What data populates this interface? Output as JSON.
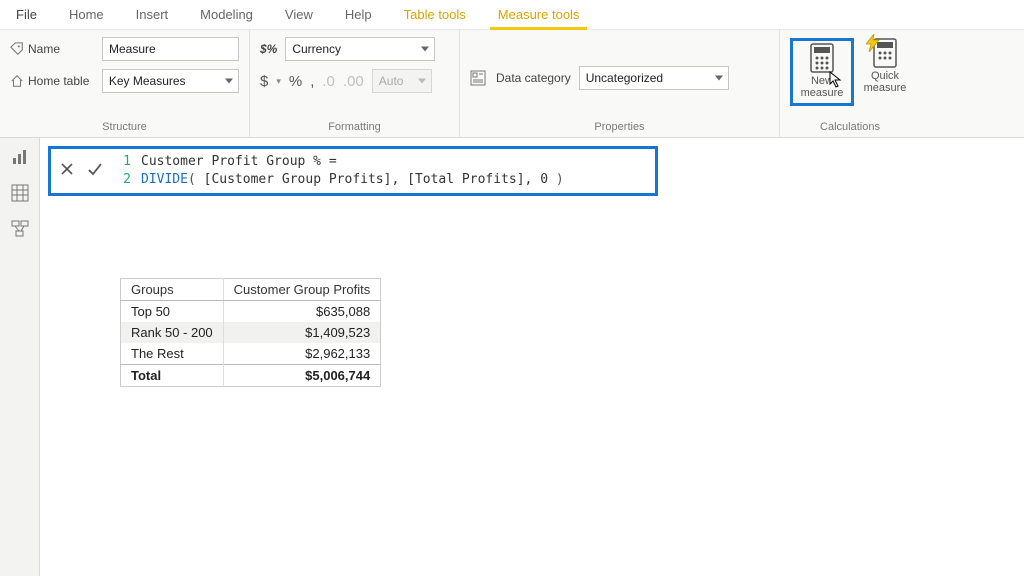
{
  "menubar": {
    "file": "File",
    "items": [
      "Home",
      "Insert",
      "Modeling",
      "View",
      "Help"
    ],
    "contextual": [
      "Table tools",
      "Measure tools"
    ],
    "active": "Measure tools"
  },
  "ribbon": {
    "structure": {
      "name_label": "Name",
      "name_value": "Measure",
      "home_table_label": "Home table",
      "home_table_value": "Key Measures",
      "group_label": "Structure"
    },
    "formatting": {
      "format_prefix": "$%",
      "format_value": "Currency",
      "dollar": "$",
      "percent": "%",
      "comma": ",",
      "dec_inc": ".0",
      "dec_dec": ".00",
      "decimals_value": "Auto",
      "group_label": "Formatting"
    },
    "properties": {
      "data_category_label": "Data category",
      "data_category_value": "Uncategorized",
      "group_label": "Properties"
    },
    "calculations": {
      "new_measure": "New measure",
      "quick_measure": "Quick measure",
      "group_label": "Calculations"
    }
  },
  "formula": {
    "line1_prefix": "Customer Profit Group % =",
    "line2_func": "DIVIDE",
    "line2_open": "(",
    "line2_arg1": " [Customer Group Profits]",
    "line2_sep1": ", ",
    "line2_arg2": "[Total Profits]",
    "line2_sep2": ", ",
    "line2_arg3": "0 ",
    "line2_close": ")"
  },
  "table": {
    "headers": [
      "Groups",
      "Customer Group Profits"
    ],
    "rows": [
      {
        "group": "Top 50",
        "value": "$635,088"
      },
      {
        "group": "Rank 50 - 200",
        "value": "$1,409,523"
      },
      {
        "group": "The Rest",
        "value": "$2,962,133"
      }
    ],
    "total": {
      "group": "Total",
      "value": "$5,006,744"
    }
  }
}
